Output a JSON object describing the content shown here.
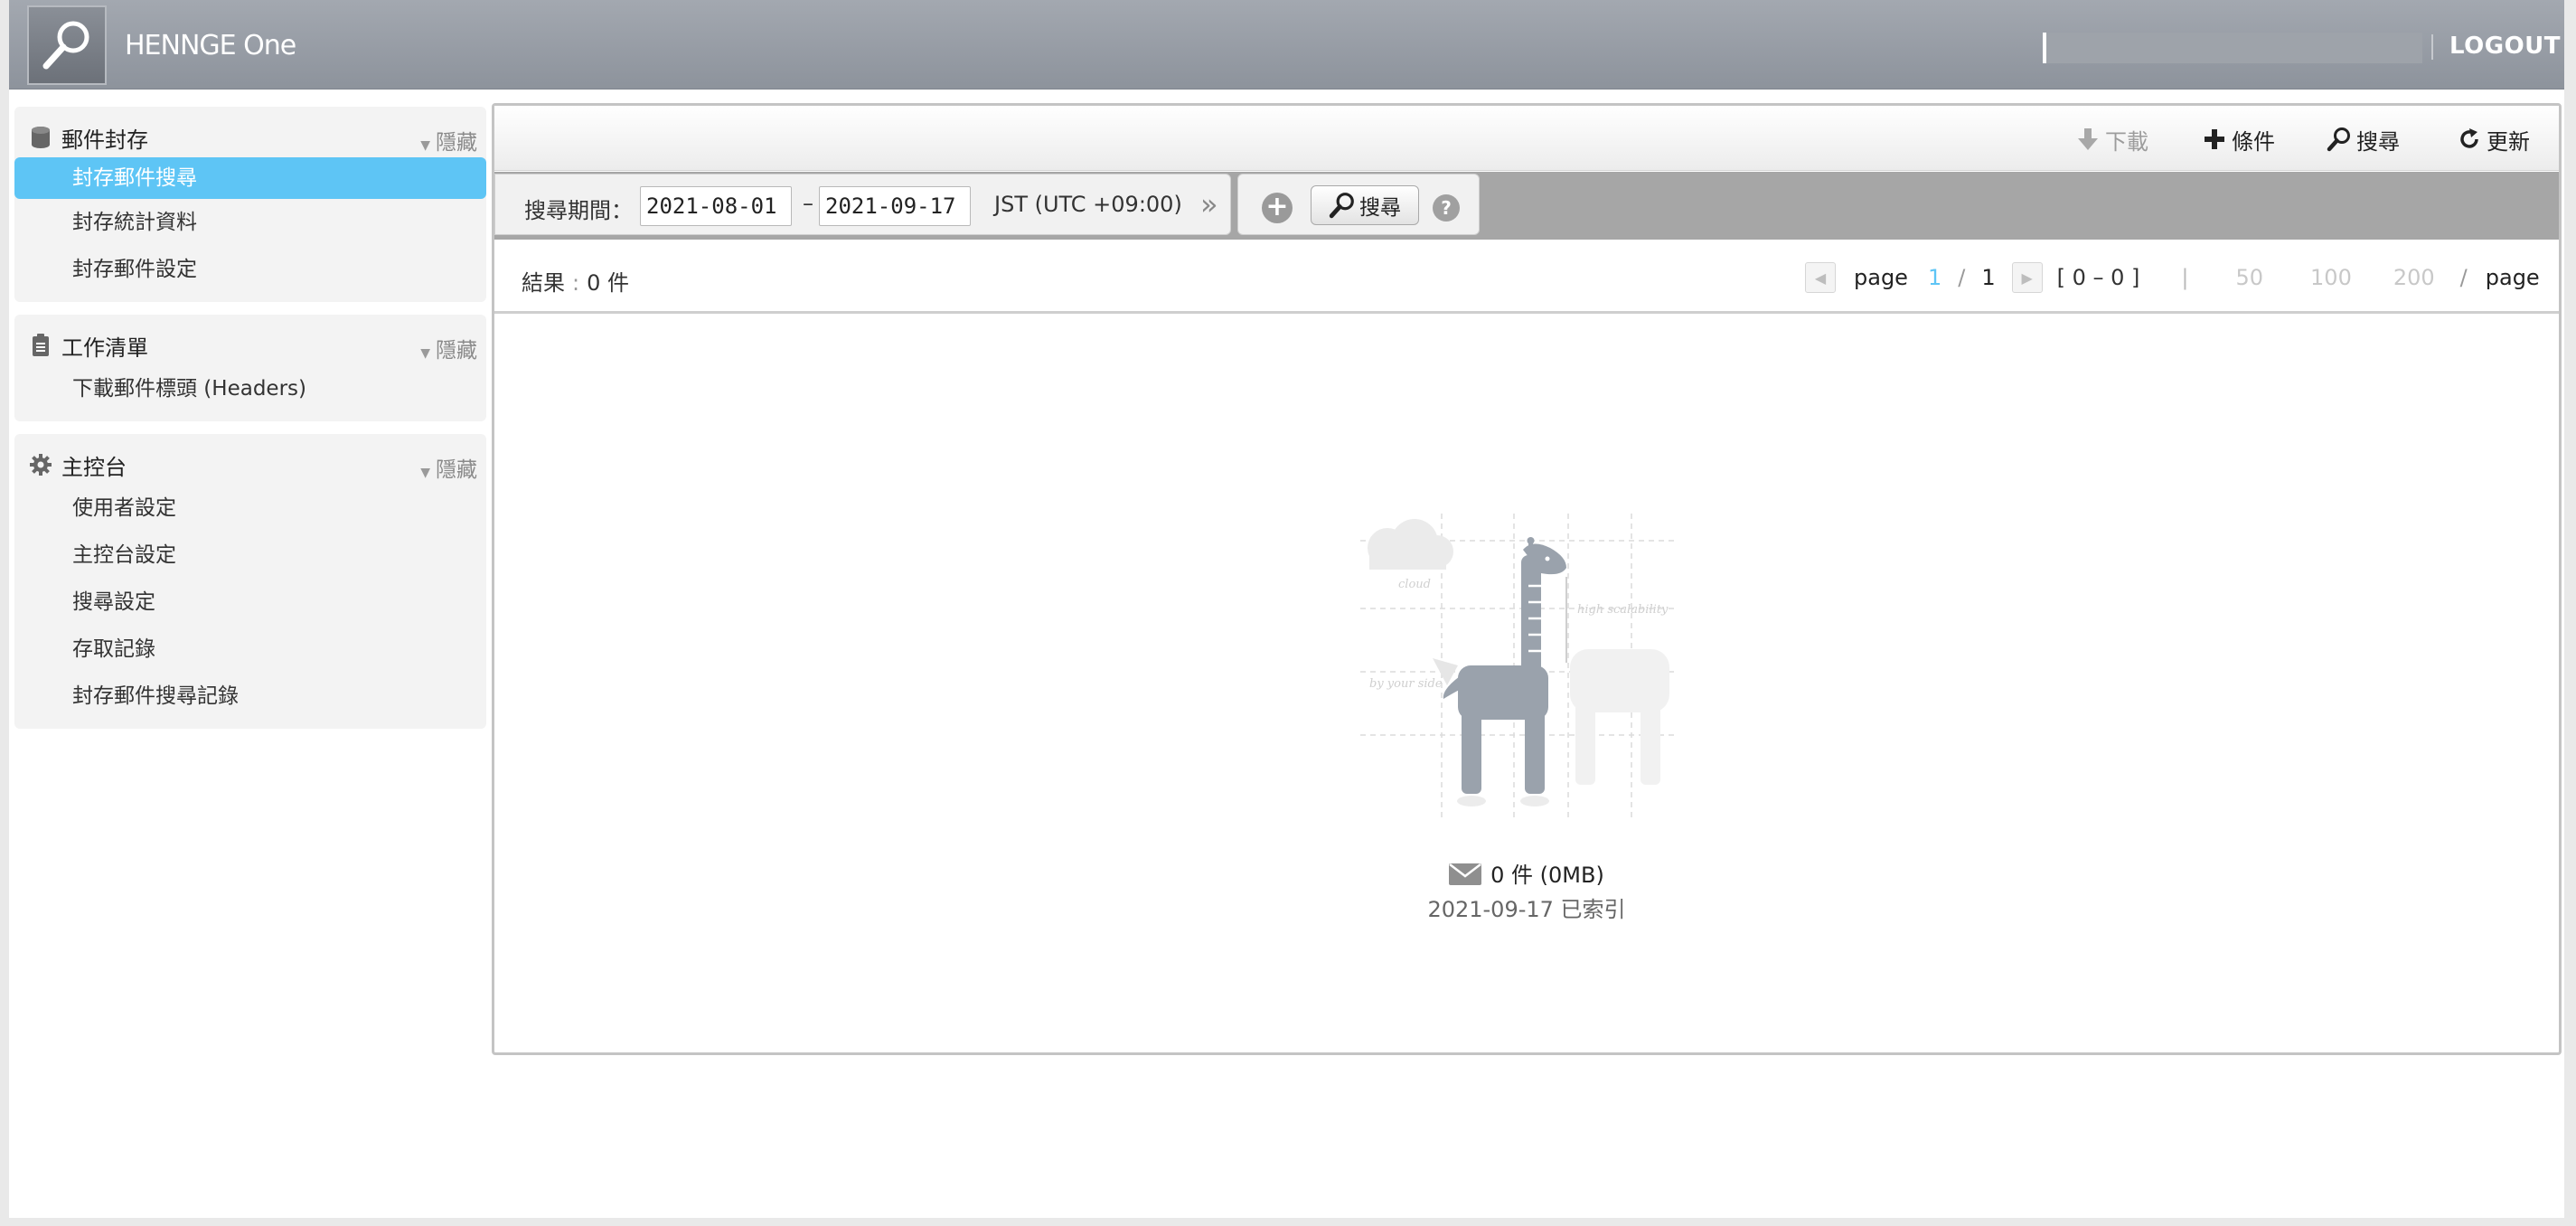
{
  "header": {
    "brand": "HENNGE One",
    "logout_label": "LOGOUT"
  },
  "sidebar": {
    "sections": [
      {
        "title": "郵件封存",
        "hide_label": "隱藏",
        "icon": "database-icon",
        "items": [
          {
            "label": "封存郵件搜尋",
            "active": true
          },
          {
            "label": "封存統計資料"
          },
          {
            "label": "封存郵件設定"
          }
        ]
      },
      {
        "title": "工作清單",
        "hide_label": "隱藏",
        "icon": "clipboard-icon",
        "items": [
          {
            "label": "下載郵件標頭 (Headers)"
          }
        ]
      },
      {
        "title": "主控台",
        "hide_label": "隱藏",
        "icon": "gear-icon",
        "items": [
          {
            "label": "使用者設定"
          },
          {
            "label": "主控台設定"
          },
          {
            "label": "搜尋設定"
          },
          {
            "label": "存取記錄"
          },
          {
            "label": "封存郵件搜尋記錄"
          }
        ]
      }
    ]
  },
  "toolbar": {
    "download_label": "下載",
    "condition_label": "條件",
    "search_label": "搜尋",
    "refresh_label": "更新"
  },
  "filter": {
    "period_label": "搜尋期間：",
    "start_date": "2021-08-01",
    "dash": "–",
    "end_date": "2021-09-17",
    "timezone": "JST (UTC +09:00)",
    "chevron": "»",
    "search_button_label": "搜尋",
    "help_label": "?"
  },
  "results": {
    "label": "結果",
    "colon": ":",
    "count": "0 件",
    "page_word": "page",
    "current_page": "1",
    "slash": "/",
    "total_pages": "1",
    "range": "[ 0 – 0 ]",
    "divider": "|",
    "per_page_options": [
      "50",
      "100",
      "200"
    ],
    "per_page_suffix": "page"
  },
  "empty_state": {
    "stat": "0 件 (0MB)",
    "indexed": "2021-09-17 已索引",
    "illustration_words": [
      "cloud",
      "high scalability",
      "by your side"
    ]
  },
  "colors": {
    "header": "#979ca4",
    "active_nav": "#5ec5f5",
    "current_page": "#5ec5f5"
  }
}
